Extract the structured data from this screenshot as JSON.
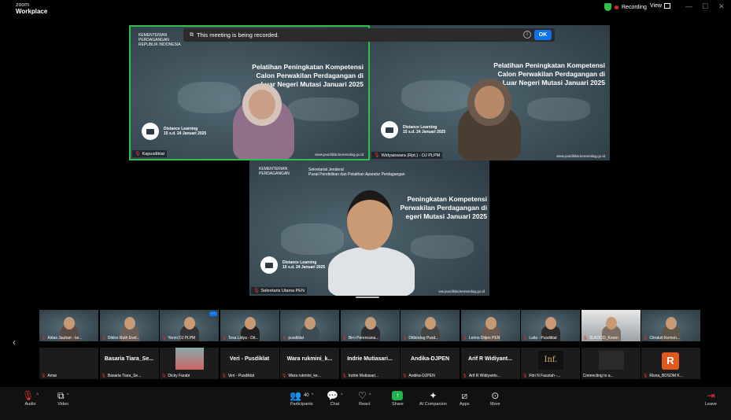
{
  "window": {
    "brand_top": "zoom",
    "brand_bottom": "Workplace",
    "recording_label": "Recording",
    "view_label": "View",
    "minimize_glyph": "—",
    "maximize_glyph": "☐",
    "close_glyph": "✕"
  },
  "banner": {
    "text": "This meeting is being recorded.",
    "info_glyph": "i",
    "ok_label": "OK"
  },
  "slide": {
    "org_name_1": "KEMENTERIAN",
    "org_name_2": "PERDAGANGAN",
    "org_sub": "REPUBLIK INDONESIA",
    "dept_1": "Sekretariat Jenderal",
    "dept_2": "Pusat Pendidikan dan Pelatihan Aparatur Perdagangan",
    "title_1": "Pelatihan Peningkatan Kompetensi",
    "title_2": "Calon Perwakilan Perdagangan di",
    "title_3": "Luar Negeri Mutasi Januari 2025",
    "title_short_1": "Peningkatan Kompetensi",
    "title_short_2": "Perwakilan Perdagangan di",
    "title_short_3": "egeri Mutasi Januari 2025",
    "dl_1": "Distance Learning",
    "dl_2": "15 s.d. 24 Januari 2025",
    "url": "www.pusdiklat.kemendag.go.id",
    "url_short": "ww.pusdiklat.kemendag.go.id"
  },
  "tiles": {
    "tl_name": "Kapusdiklat",
    "tr_name": "Widyaiswara (Rpt.) - DJ PLPM",
    "center_name": "Sekretaris Utama PEN"
  },
  "gallery": {
    "row1": [
      "Aldas Jauhari - ke...",
      "Dikles Ruth Evel...",
      "Yenni DJ PLPM",
      "Tesa Lidya - Dit...",
      "pusdiklat",
      "Biro Perencana...",
      "Ditbindag Pusd...",
      "Lerins Ditjen PEN",
      "Laila - Pusdiklat",
      "SLKOCO_Koren",
      "Citratuti Kemen..."
    ],
    "row2_big": [
      "",
      "Basaria Tiara_Se...",
      "",
      "Veri - Pusdiklat",
      "Wara rukmini_k...",
      "Indrie Mutiasari...",
      "Andika-DJPEN",
      "Arif R Widiyant...",
      "",
      "",
      ""
    ],
    "row2": [
      "Amar",
      "Basaria Tiara_Se...",
      "Dicky Farabi",
      "Veri - Pusdiklat",
      "Wara rukmini_ke...",
      "Indrie Mutiasari...",
      "Andika-DJPEN",
      "Arif R Widiyanto...",
      "Fitri N Fauziah -...",
      "Connecting to a...",
      "Risna_BDSDM K..."
    ],
    "logo_text": "Inf.",
    "avatar_letter": "R",
    "more_glyph": "···",
    "prev_glyph": "‹"
  },
  "toolbar": {
    "audio": "Audio",
    "video": "Video",
    "participants": "Participants",
    "participants_count": "40",
    "chat": "Chat",
    "react": "React",
    "share": "Share",
    "ai": "AI Companion",
    "apps": "Apps",
    "more": "More",
    "leave": "Leave"
  },
  "colors": {
    "active_speaker_border": "#2fbf4a",
    "recording_dot": "#e02828",
    "ok_button": "#0e72ed",
    "share_button": "#22b34c"
  }
}
